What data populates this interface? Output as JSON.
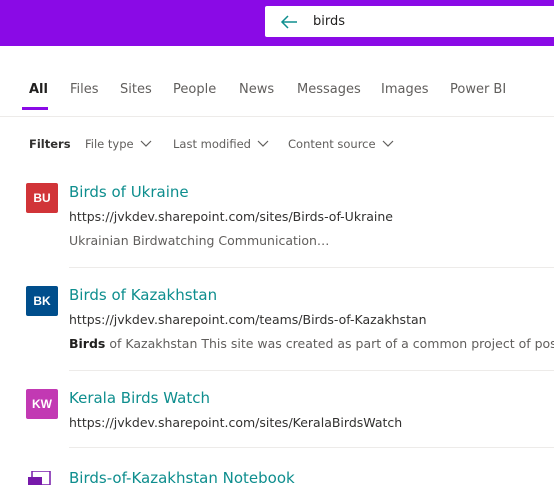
{
  "colors": {
    "accent": "#8a0ae6",
    "link": "#0e8e8e"
  },
  "search": {
    "query": "birds",
    "back_icon": "back-arrow-icon"
  },
  "tabs": [
    {
      "label": "All",
      "active": true
    },
    {
      "label": "Files"
    },
    {
      "label": "Sites"
    },
    {
      "label": "People"
    },
    {
      "label": "News"
    },
    {
      "label": "Messages"
    },
    {
      "label": "Images"
    },
    {
      "label": "Power BI"
    }
  ],
  "filters": {
    "label": "Filters",
    "items": [
      {
        "label": "File type",
        "icon": "chevron-down-icon"
      },
      {
        "label": "Last modified",
        "icon": "chevron-down-icon"
      },
      {
        "label": "Content source",
        "icon": "chevron-down-icon"
      }
    ]
  },
  "results": [
    {
      "avatar": "BU",
      "avatar_color": "#d13438",
      "title": "Birds of Ukraine",
      "url": "https://jvkdev.sharepoint.com/sites/Birds-of-Ukraine",
      "desc": "Ukrainian Birdwatching Communication…"
    },
    {
      "avatar": "BK",
      "avatar_color": "#004e8c",
      "title": "Birds of Kazakhstan",
      "url": "https://jvkdev.sharepoint.com/teams/Birds-of-Kazakhstan",
      "desc_highlight": "Birds",
      "desc_rest": " of Kazakhstan This site was created as part of a common project of post"
    },
    {
      "avatar": "KW",
      "avatar_color": "#c239b3",
      "title": "Kerala Birds Watch",
      "url": "https://jvkdev.sharepoint.com/sites/KeralaBirdsWatch"
    },
    {
      "avatar_icon": "onenote-notebook-icon",
      "avatar_color": "#7719aa",
      "title": "Birds-of-Kazakhstan Notebook"
    }
  ]
}
